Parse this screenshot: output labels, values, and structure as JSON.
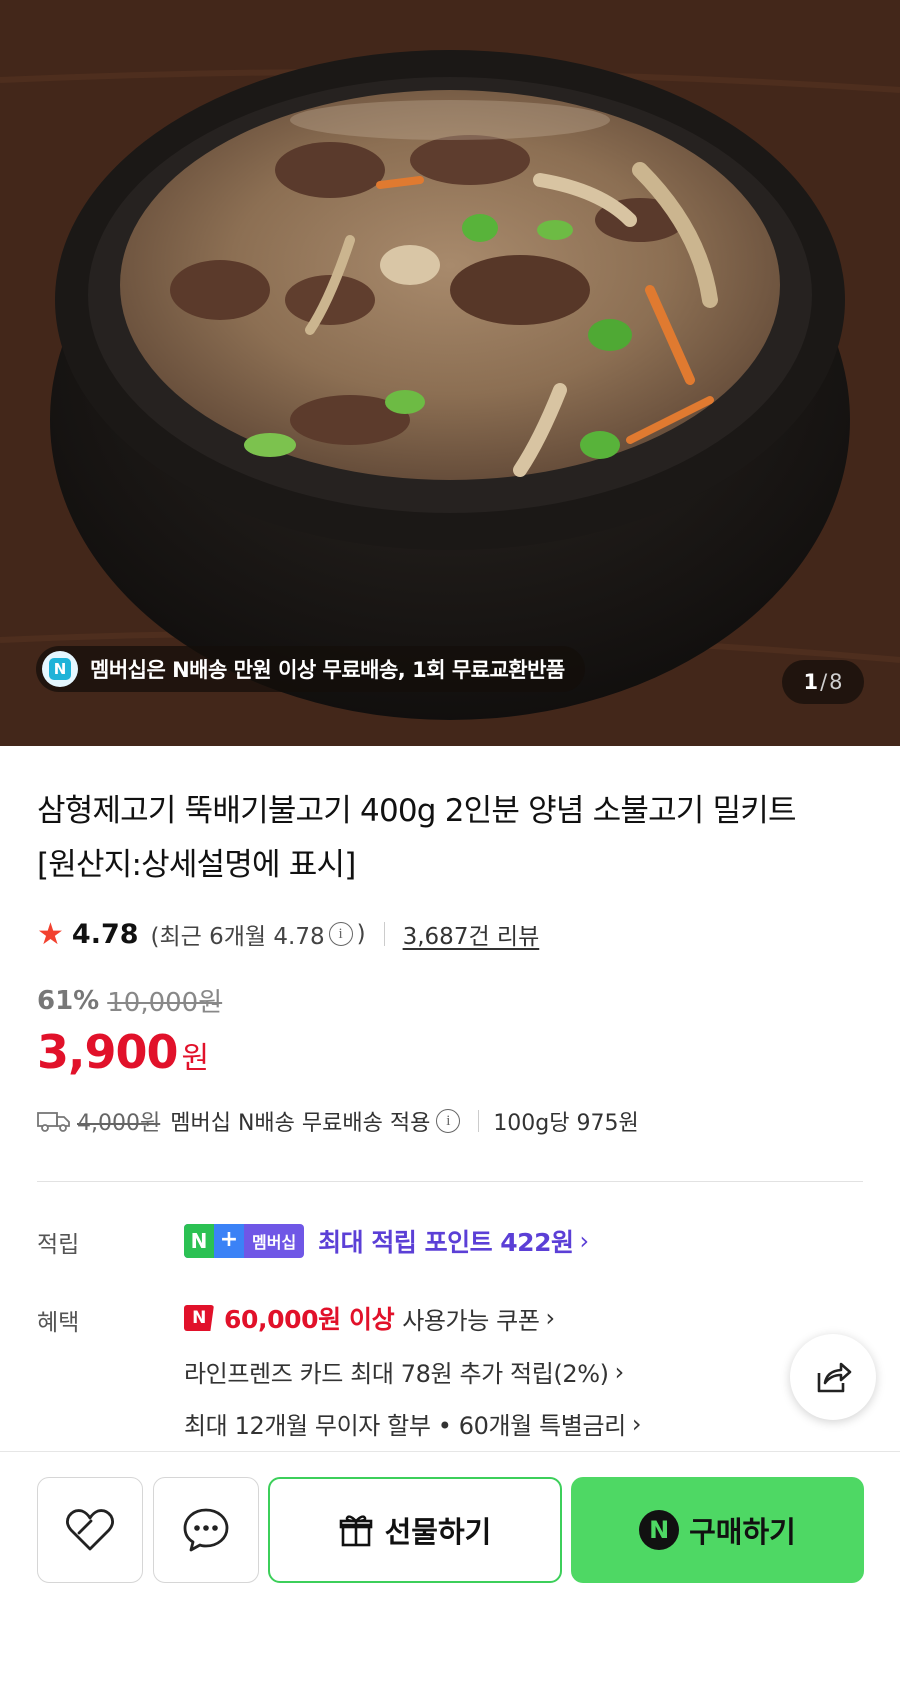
{
  "hero": {
    "image_alt": "뚝배기불고기",
    "banner_badge": "N",
    "banner_text": "멤버십은 N배송 만원 이상 무료배송, 1회 무료교환반품",
    "counter_current": "1",
    "counter_sep": "/",
    "counter_total": "8"
  },
  "product": {
    "title": "삼형제고기 뚝배기불고기 400g 2인분 양념 소불고기 밀키트 [원산지:상세설명에 표시]",
    "rating": "4.78",
    "recent_rating_text": "(최근 6개월 4.78",
    "recent_rating_close": ")",
    "review_count": "3,687건 리뷰",
    "discount_rate": "61%",
    "original_price": "10,000원",
    "price": "3,900",
    "price_unit": "원",
    "shipping_original": "4,000원",
    "shipping_text": "멤버십 N배송 무료배송 적용",
    "unit_price": "100g당 975원"
  },
  "rewards": {
    "label": "적립",
    "badge_n": "N",
    "badge_plus": "+",
    "badge_membership": "멤버십",
    "point_text": "최대 적립 포인트 422원"
  },
  "benefits": {
    "label": "혜택",
    "badge_n": "N",
    "coupon_amount": "60,000원 이상",
    "coupon_text": "사용가능 쿠폰",
    "card_text": "라인프렌즈 카드 최대 78원 추가 적립(2%)",
    "installment_text": "최대 12개월 무이자 할부 • 60개월 특별금리"
  },
  "actions": {
    "gift_label": "선물하기",
    "buy_badge": "N",
    "buy_label": "구매하기"
  },
  "icons": {
    "star": "star-icon",
    "truck": "truck-icon",
    "info": "info-icon",
    "share": "share-icon",
    "like": "heart-icon",
    "chat": "chat-icon",
    "gift": "gift-icon"
  },
  "colors": {
    "price_red": "#e1112a",
    "point_purple": "#5b3fd6",
    "buy_green": "#4ed864",
    "star_red": "#f2412f"
  }
}
